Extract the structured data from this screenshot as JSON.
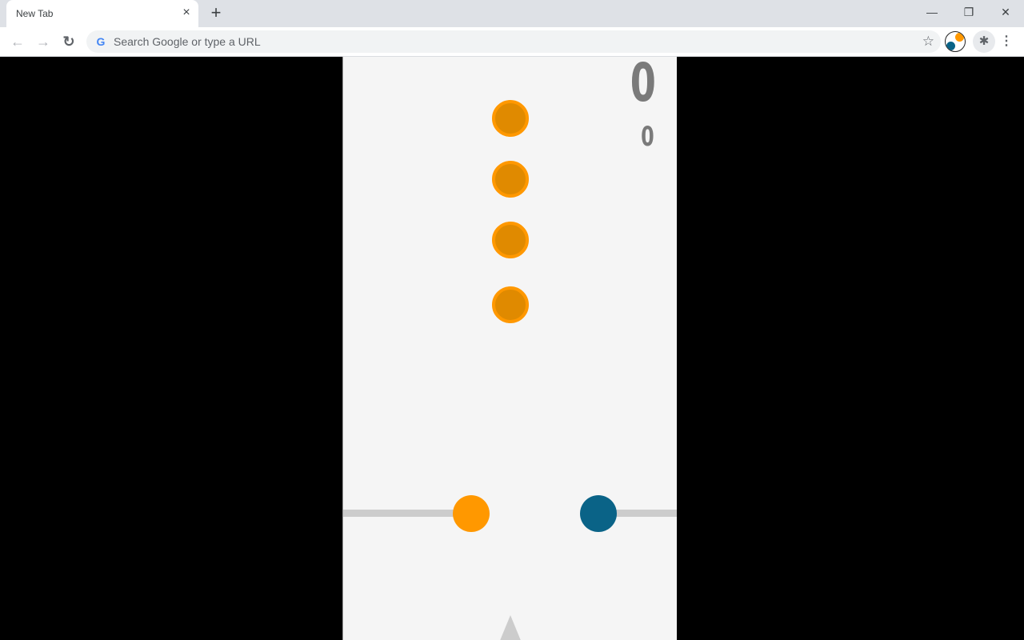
{
  "browser": {
    "tab_title": "New Tab",
    "tab_close_icon": "×",
    "new_tab_icon": "+",
    "minimize_icon": "—",
    "restore_icon": "❐",
    "close_icon": "✕",
    "back_icon": "←",
    "forward_icon": "→",
    "reload_icon": "↻",
    "google_icon": "G",
    "omnibox_placeholder": "Search Google or type a URL",
    "bookmark_icon": "☆",
    "extensions_icon": "✱",
    "menu_icon": "⋮"
  },
  "game": {
    "score": "0",
    "best_score": "0",
    "colors": {
      "background": "#f5f5f5",
      "orange": "#ff9800",
      "orange_inner": "#e08a00",
      "blue": "#0a6387",
      "track": "#cccccc",
      "score_text": "#7a7a7a"
    },
    "falling_dots": [
      {
        "color": "orange"
      },
      {
        "color": "orange"
      },
      {
        "color": "orange"
      },
      {
        "color": "orange"
      }
    ],
    "player_balls": [
      {
        "color": "orange",
        "side": "left"
      },
      {
        "color": "blue",
        "side": "right"
      }
    ]
  }
}
